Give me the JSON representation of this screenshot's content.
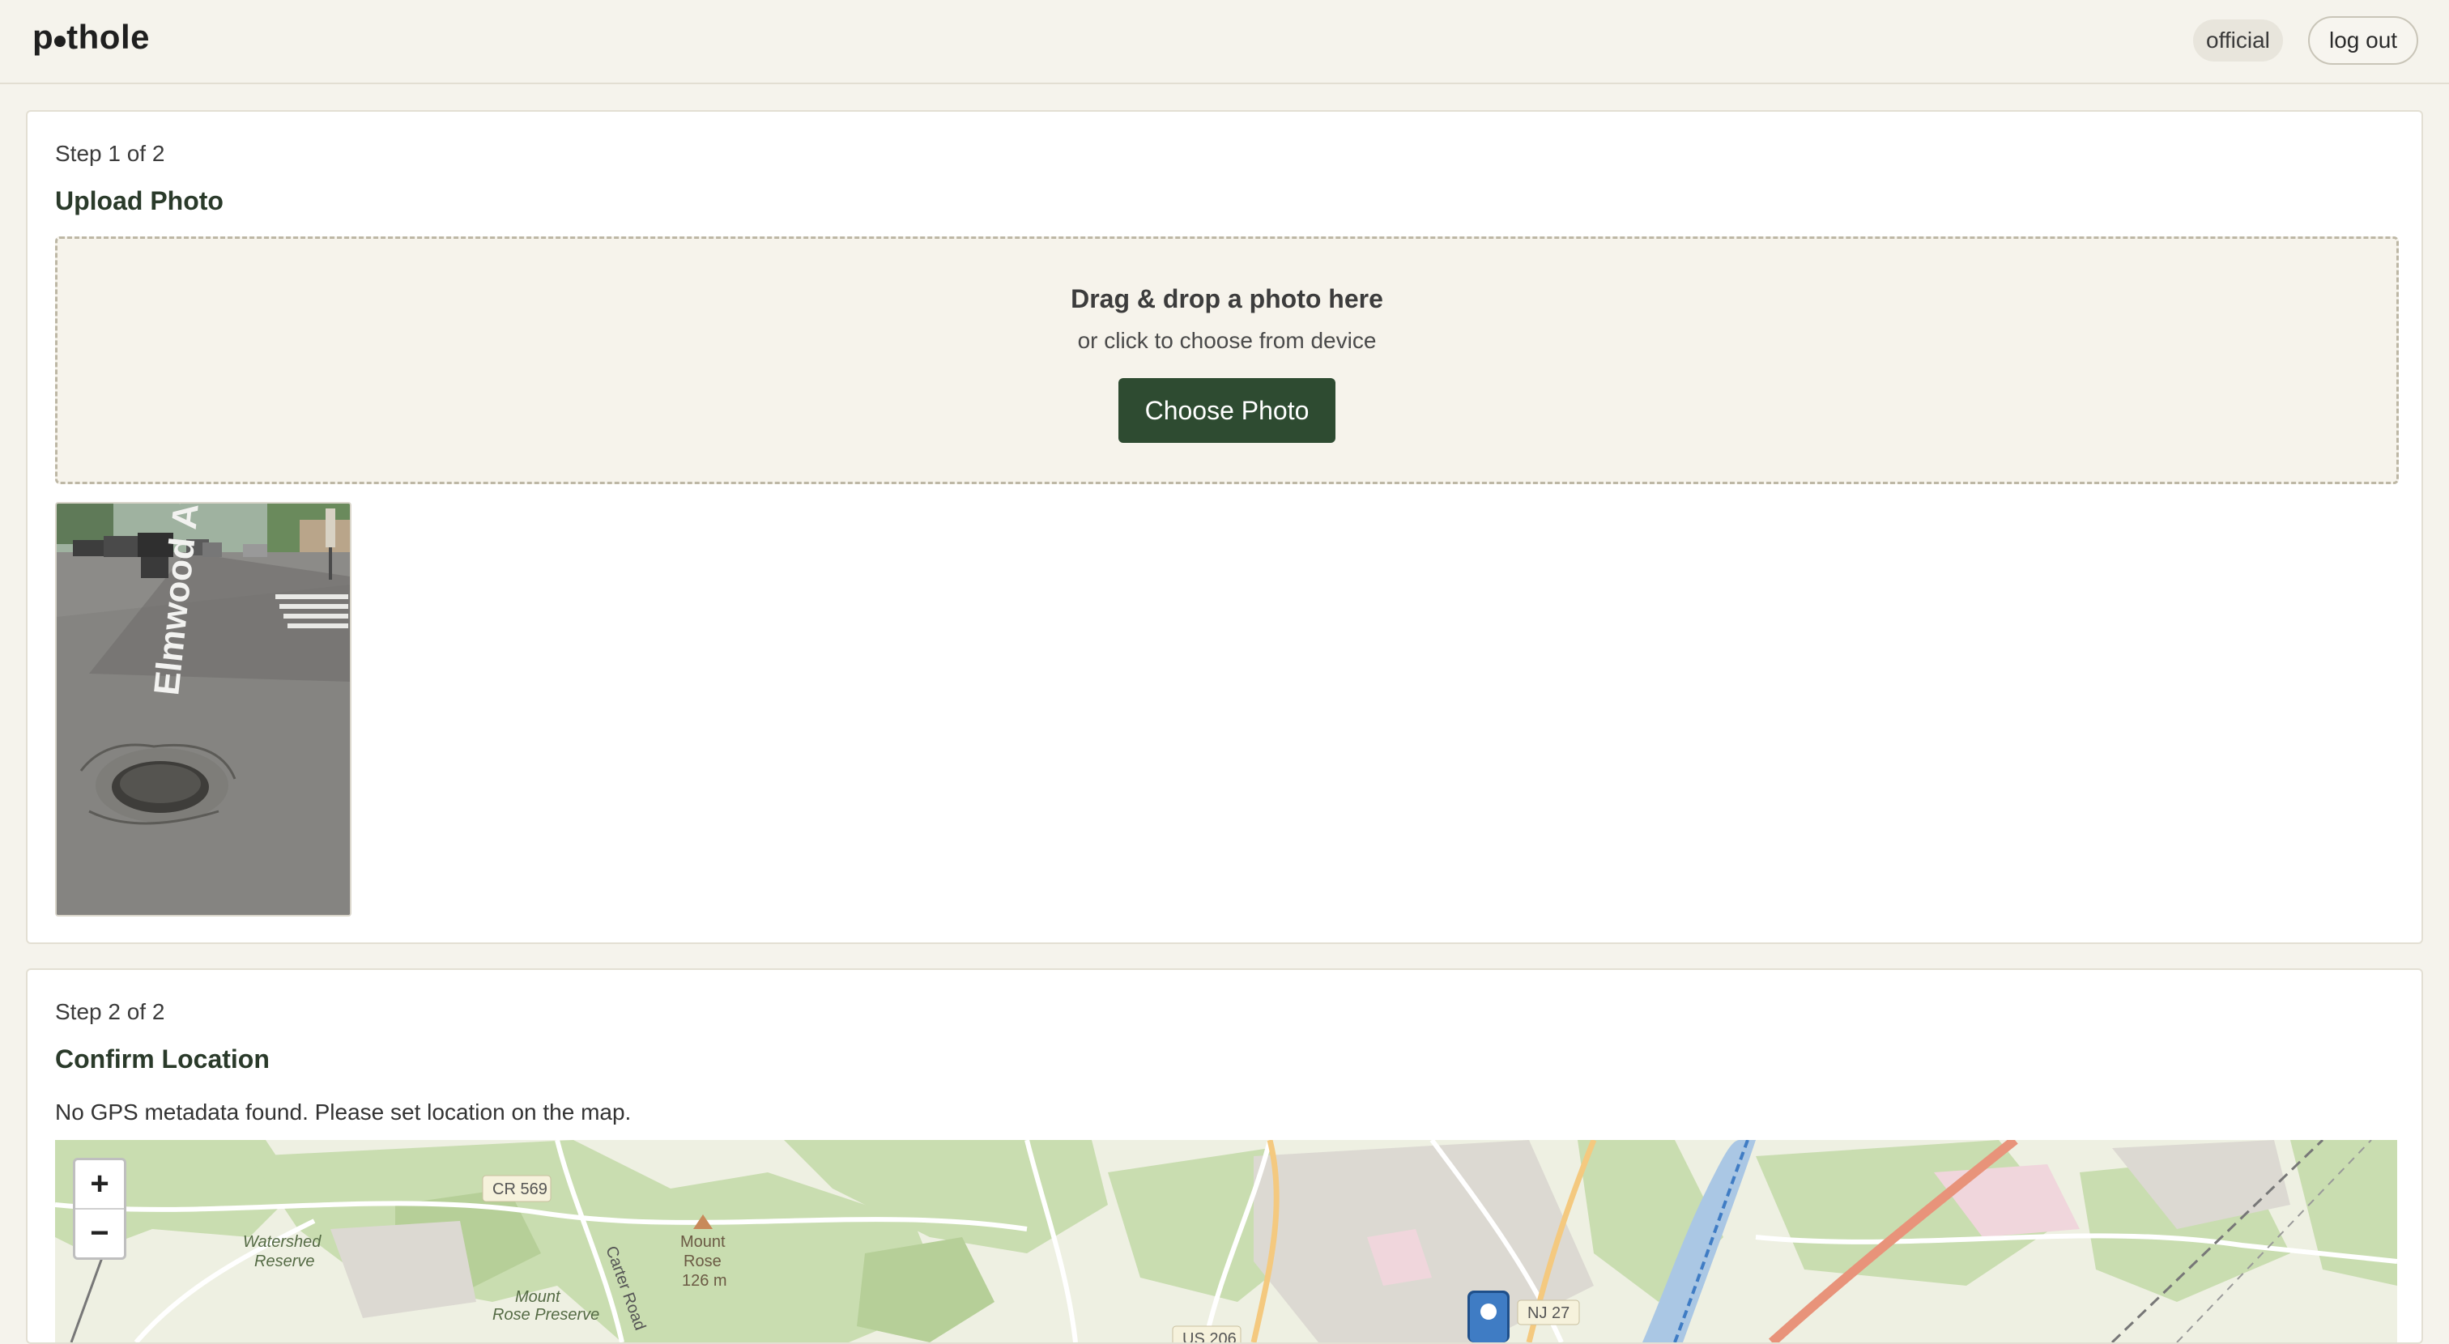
{
  "header": {
    "logo_left": "p",
    "logo_right": "thole",
    "role_badge": "official",
    "logout_label": "log out"
  },
  "step1": {
    "step_label": "Step 1 of 2",
    "title": "Upload Photo",
    "dropzone": {
      "heading": "Drag & drop a photo here",
      "subtext": "or click to choose from device",
      "button_label": "Choose Photo"
    },
    "photo": {
      "street_marking": "Elmwood Ave"
    }
  },
  "step2": {
    "step_label": "Step 2 of 2",
    "title": "Confirm Location",
    "status_message": "No GPS metadata found. Please set location on the map.",
    "map": {
      "zoom_in_label": "+",
      "zoom_out_label": "−",
      "labels": {
        "cr569": "CR 569",
        "watershed_1": "Watershed",
        "watershed_2": "Reserve",
        "mount_rose_1": "Mount",
        "mount_rose_2": "Rose",
        "mount_rose_3": "126 m",
        "preserve_1": "Mount",
        "preserve_2": "Rose Preserve",
        "carter": "Carter Road",
        "nj27": "NJ 27",
        "us206": "US 206"
      }
    }
  },
  "colors": {
    "page_bg": "#f5f3ec",
    "accent_green": "#2e4b31",
    "map_forest": "#c9ddb0",
    "marker_blue": "#3f7cc4",
    "highway_orange": "#e8937a"
  }
}
